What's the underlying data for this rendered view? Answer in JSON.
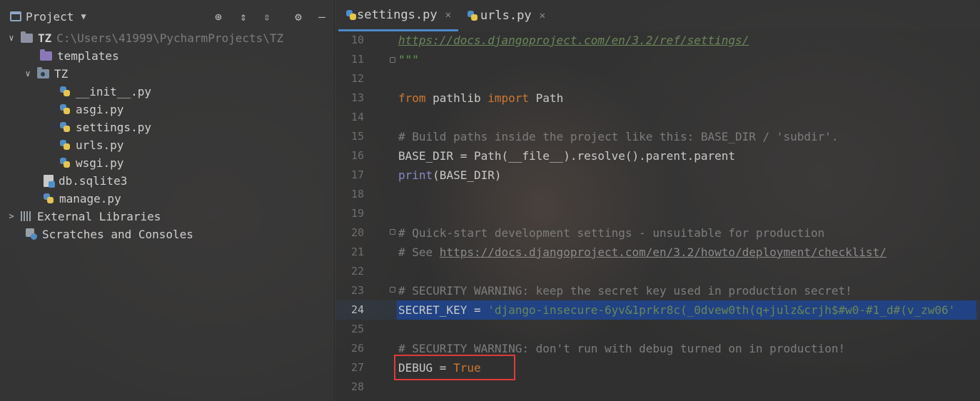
{
  "project_panel": {
    "title": "Project",
    "toolbar_icons": [
      "crosshair-icon",
      "expand-all-icon",
      "collapse-all-icon",
      "gear-icon",
      "minimize-icon"
    ],
    "tree": [
      {
        "label": "TZ",
        "path": "C:\\Users\\41999\\PycharmProjects\\TZ",
        "type": "folder"
      },
      {
        "label": "templates",
        "type": "folder"
      },
      {
        "label": "TZ",
        "type": "folder"
      },
      {
        "label": "__init__.py",
        "type": "python"
      },
      {
        "label": "asgi.py",
        "type": "python"
      },
      {
        "label": "settings.py",
        "type": "python"
      },
      {
        "label": "urls.py",
        "type": "python"
      },
      {
        "label": "wsgi.py",
        "type": "python"
      },
      {
        "label": "db.sqlite3",
        "type": "file"
      },
      {
        "label": "manage.py",
        "type": "python"
      },
      {
        "label": "External Libraries",
        "type": "libraries"
      },
      {
        "label": "Scratches and Consoles",
        "type": "scratches"
      }
    ]
  },
  "editor": {
    "tabs": [
      {
        "label": "settings.py",
        "active": true
      },
      {
        "label": "urls.py",
        "active": false
      }
    ],
    "current_line": 24,
    "lines": [
      {
        "n": "10",
        "text": "https://docs.djangoproject.com/en/3.2/ref/settings/"
      },
      {
        "n": "11",
        "text": "\"\"\""
      },
      {
        "n": "12",
        "text": ""
      },
      {
        "n": "13",
        "text": "from pathlib import Path"
      },
      {
        "n": "14",
        "text": ""
      },
      {
        "n": "15",
        "text": "# Build paths inside the project like this: BASE_DIR / 'subdir'."
      },
      {
        "n": "16",
        "text": "BASE_DIR = Path(__file__).resolve().parent.parent"
      },
      {
        "n": "17",
        "text": "print(BASE_DIR)"
      },
      {
        "n": "18",
        "text": ""
      },
      {
        "n": "19",
        "text": ""
      },
      {
        "n": "20",
        "text": "# Quick-start development settings - unsuitable for production"
      },
      {
        "n": "21",
        "text": "# See https://docs.djangoproject.com/en/3.2/howto/deployment/checklist/"
      },
      {
        "n": "22",
        "text": ""
      },
      {
        "n": "23",
        "text": "# SECURITY WARNING: keep the secret key used in production secret!"
      },
      {
        "n": "24",
        "text": "SECRET_KEY = 'django-insecure-6yv&1prkr8c(_0dvew0th(q+julz&crjh$#w0-#1_d#(v_zw06'"
      },
      {
        "n": "25",
        "text": ""
      },
      {
        "n": "26",
        "text": "# SECURITY WARNING: don't run with debug turned on in production!"
      },
      {
        "n": "27",
        "text": "DEBUG = True"
      },
      {
        "n": "28",
        "text": ""
      }
    ],
    "tokens": {
      "l10": "https://docs.djangoproject.com/en/3.2/ref/settings/",
      "l11": "\"\"\"",
      "l13_from": "from",
      "l13_mod": " pathlib ",
      "l13_import": "import",
      "l13_name": " Path",
      "l15": "# Build paths inside the project like this: BASE_DIR / 'subdir'.",
      "l16": "BASE_DIR = Path(__file__).resolve().parent.parent",
      "l17_fn": "print",
      "l17_rest": "(BASE_DIR)",
      "l20": "# Quick-start development settings - unsuitable for production",
      "l21_pre": "# See ",
      "l21_link": "https://docs.djangoproject.com/en/3.2/howto/deployment/checklist/",
      "l23": "# SECURITY WARNING: keep the secret key used in production secret!",
      "l24_name": "SECRET_KEY = ",
      "l24_str": "'django-insecure-6yv&1prkr8c(_0dvew0th(q+julz&crjh$#w0-#1_d#(v_zw06'",
      "l26": "# SECURITY WARNING: don't run with debug turned on in production!",
      "l27_name": "DEBUG = ",
      "l27_val": "True"
    },
    "highlight_color": "#e03a3a"
  }
}
